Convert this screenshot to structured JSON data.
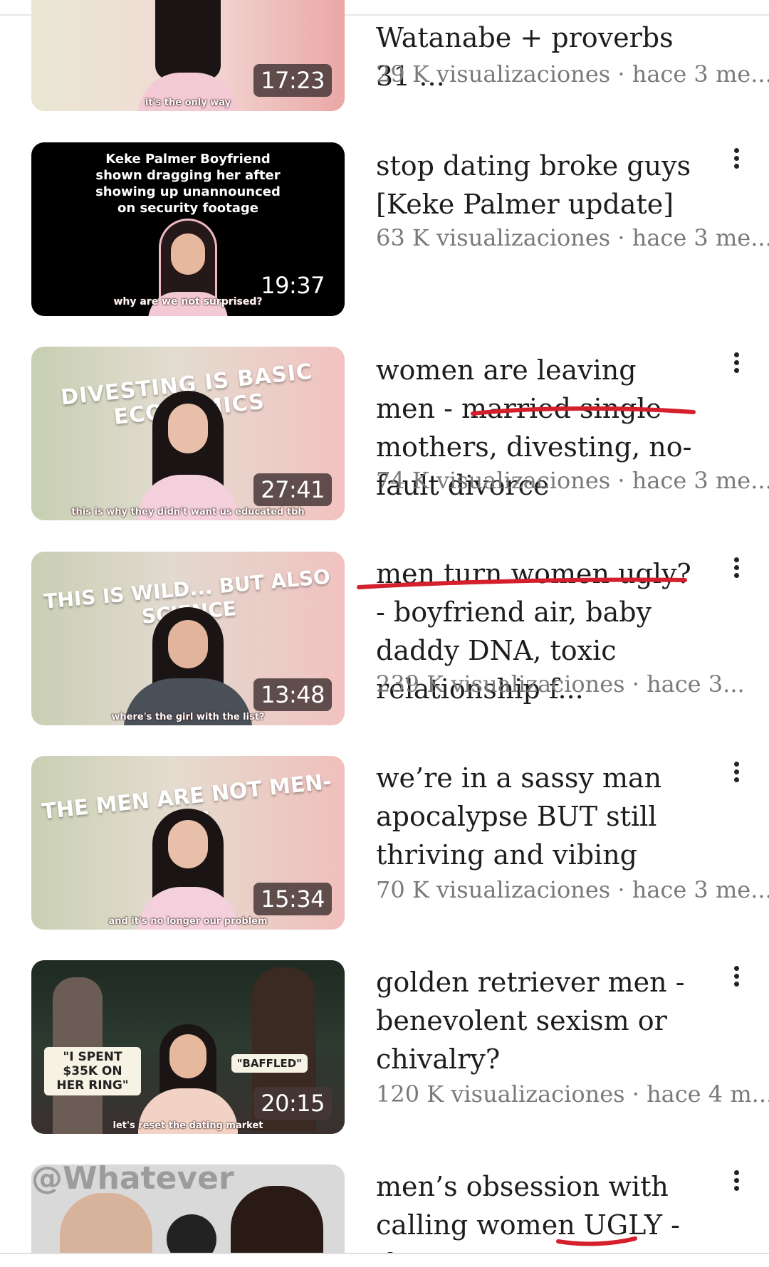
{
  "videos": [
    {
      "duration": "17:23",
      "title_line_partial": "Watanabe + proverbs 31 ...",
      "caption": "it's the only way",
      "views": "29 K visualizaciones",
      "age": "hace 3 me..."
    },
    {
      "duration": "19:37",
      "title": "stop dating broke guys [Keke Palmer update]",
      "thumb_text": "Keke Palmer Boyfriend shown dragging her after showing up unannounced on security footage",
      "caption": "why are we not surprised?",
      "views": "63 K visualizaciones",
      "age": "hace 3 me..."
    },
    {
      "duration": "27:41",
      "title": "women are leaving men - married single mothers, divesting, no-fault divorce",
      "thumb_text": "DIVESTING IS BASIC ECONOMICS",
      "caption": "this is why they didn't want us educated tbh",
      "views": "74 K visualizaciones",
      "age": "hace 3 me..."
    },
    {
      "duration": "13:48",
      "title": "men turn women ugly? - boyfriend air, baby daddy DNA, toxic relationship f...",
      "thumb_text": "THIS IS WILD... BUT ALSO SCIENCE",
      "caption": "where's the girl with the list?",
      "views": "239 K visualizaciones",
      "age": "hace 3..."
    },
    {
      "duration": "15:34",
      "title": "we’re in a sassy man apocalypse BUT still thriving and vibing",
      "thumb_text": "THE MEN ARE NOT MEN-ING",
      "caption": "and it's no longer our problem",
      "views": "70 K visualizaciones",
      "age": "hace 3 me..."
    },
    {
      "duration": "20:15",
      "title": "golden retriever men - benevolent sexism or chivalry?",
      "thumb_text_left": "\"I SPENT $35K ON HER RING\"",
      "thumb_text_right": "\"BAFFLED\"",
      "caption": "let's reset the dating market",
      "views": "120 K visualizaciones",
      "age": "hace 4 m..."
    },
    {
      "title_partial": "men’s obsession with calling women UGLY - the",
      "thumb_text": "@Whatever"
    }
  ],
  "colors": {
    "annotation_red": "#d4202c",
    "meta_gray": "#7a7a7a",
    "title_text": "#1d1d1d"
  }
}
